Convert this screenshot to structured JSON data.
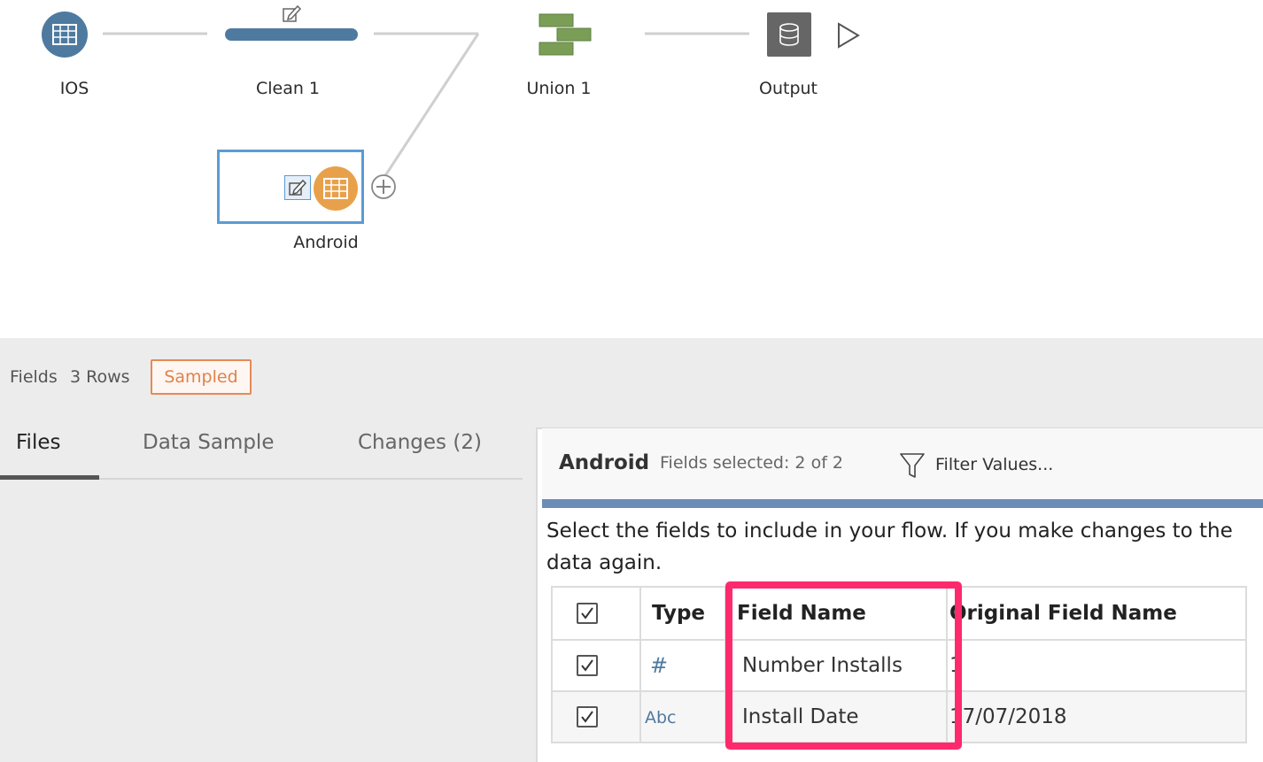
{
  "flow": {
    "nodes": {
      "ios": "IOS",
      "clean": "Clean 1",
      "union": "Union 1",
      "output": "Output",
      "android": "Android"
    },
    "colors": {
      "input_node": "#4f7aa0",
      "selected_input": "#e8a14a",
      "union": "#7a9e56",
      "output": "#666666"
    }
  },
  "panel": {
    "fields_label": "Fields",
    "rows_label": "3 Rows",
    "sampled_badge": "Sampled",
    "tabs": [
      {
        "label": "Files",
        "active": true
      },
      {
        "label": "Data Sample",
        "active": false
      },
      {
        "label": "Changes (2)",
        "active": false
      }
    ]
  },
  "detail": {
    "title": "Android",
    "fields_selected": "Fields selected: 2 of 2",
    "filter_label": "Filter Values...",
    "instructions": "Select the fields to include in your flow. If you make changes to the data again.",
    "table": {
      "headers": [
        "Type",
        "Field Name",
        "Original Field Name"
      ],
      "rows": [
        {
          "type": "#",
          "field_name": "Number Installs",
          "original": "1",
          "checked": true
        },
        {
          "type": "Abc",
          "field_name": "Install Date",
          "original": "17/07/2018",
          "checked": true
        }
      ]
    }
  }
}
